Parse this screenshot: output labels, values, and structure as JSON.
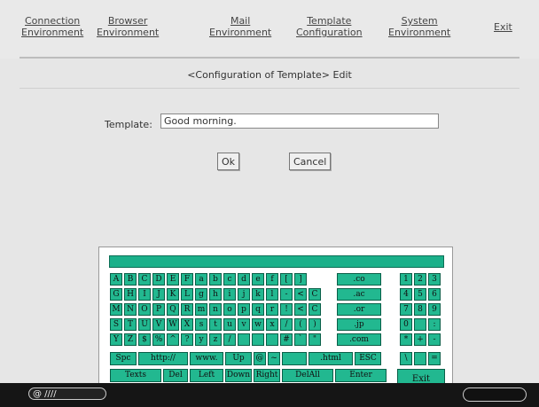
{
  "nav": {
    "items": [
      {
        "line1": "Connection",
        "line2": "Environment"
      },
      {
        "line1": "Browser",
        "line2": "Environment"
      },
      {
        "line1": "Mail",
        "line2": "Environment"
      },
      {
        "line1": "Template",
        "line2": "Configuration"
      },
      {
        "line1": "System",
        "line2": "Environment"
      },
      {
        "line1": "Exit",
        "line2": ""
      }
    ]
  },
  "page": {
    "title": "<Configuration of Template> Edit",
    "field_label": "Template:",
    "field_value": "Good morning.",
    "ok_label": "Ok",
    "cancel_label": "Cancel"
  },
  "keyboard": {
    "rows": [
      [
        "A",
        "B",
        "C",
        "D",
        "E",
        "F",
        "a",
        "b",
        "c",
        "d",
        "e",
        "f",
        "[",
        "]",
        ".co",
        "1",
        "2",
        "3"
      ],
      [
        "G",
        "H",
        "I",
        "J",
        "K",
        "L",
        "g",
        "h",
        "i",
        "j",
        "k",
        "l",
        "-",
        "<",
        "C",
        ".ac",
        "4",
        "5",
        "6"
      ],
      [
        "M",
        "N",
        "O",
        "P",
        "Q",
        "R",
        "m",
        "n",
        "o",
        "p",
        "q",
        "r",
        "!",
        "<",
        "C",
        ".or",
        "7",
        "8",
        "9"
      ],
      [
        "S",
        "T",
        "U",
        "V",
        "W",
        "X",
        "s",
        "t",
        "u",
        "v",
        "w",
        "x",
        "/",
        "(",
        ")",
        ".jp",
        "0",
        "",
        ":"
      ],
      [
        "Y",
        "Z",
        "$",
        "%",
        "^",
        "?",
        "y",
        "z",
        "/",
        "",
        "",
        "",
        "#",
        "`",
        "\"",
        ".com",
        "*",
        "+",
        "-"
      ],
      [
        "Spc",
        "http://",
        "www.",
        "Up",
        "@",
        "~",
        "",
        ".html",
        "ESC",
        "\\",
        "",
        "="
      ],
      [
        "Texts",
        "Del",
        "Left",
        "Down",
        "Right",
        "DelAll",
        "Enter"
      ]
    ],
    "exit_label": "Exit"
  },
  "statusbar": {
    "left_text": "@ ////"
  },
  "colors": {
    "key_fill": "#22b890",
    "key_border": "#0a5f48"
  }
}
